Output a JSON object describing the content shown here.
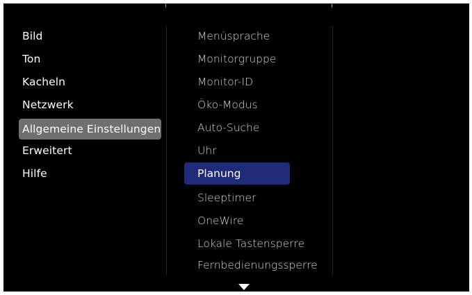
{
  "main_menu": {
    "items": [
      {
        "label": "Bild"
      },
      {
        "label": "Ton"
      },
      {
        "label": "Kacheln"
      },
      {
        "label": "Netzwerk"
      },
      {
        "label": "Allgemeine Einstellungen"
      },
      {
        "label": "Erweitert"
      },
      {
        "label": "Hilfe"
      }
    ],
    "selected_index": 4
  },
  "submenu": {
    "items": [
      {
        "label": "Menüsprache"
      },
      {
        "label": "Monitorgruppe"
      },
      {
        "label": "Monitor-ID"
      },
      {
        "label": "Öko-Modus"
      },
      {
        "label": "Auto-Suche"
      },
      {
        "label": "Uhr"
      },
      {
        "label": "Planung"
      },
      {
        "label": "Sleeptimer"
      },
      {
        "label": "OneWire"
      },
      {
        "label": "Lokale Tastensperre"
      },
      {
        "label": "Fernbedienungssperre"
      }
    ],
    "highlighted_index": 6,
    "scroll_indicator": "triangle-down-icon"
  },
  "colors": {
    "background": "#000000",
    "selected_main": "#6f6f6f",
    "highlighted_sub": "#1f2a78",
    "text": "#ffffff"
  }
}
